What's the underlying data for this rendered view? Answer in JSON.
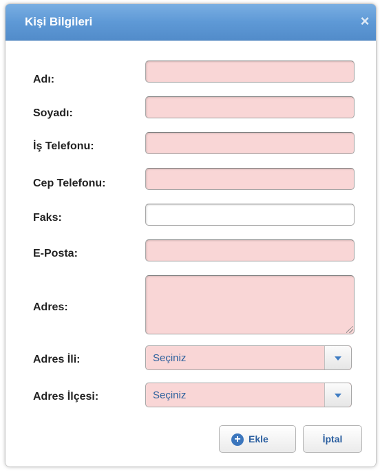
{
  "dialog": {
    "title": "Kişi Bilgileri",
    "close_icon": "×"
  },
  "form": {
    "adi_label": "Adı:",
    "soyadi_label": "Soyadı:",
    "is_telefonu_label": "İş Telefonu:",
    "cep_telefonu_label": "Cep Telefonu:",
    "faks_label": "Faks:",
    "eposta_label": "E-Posta:",
    "adres_label": "Adres:",
    "adres_ili_label": "Adres İli:",
    "adres_ilcesi_label": "Adres İlçesi:",
    "adres_ili_value": "Seçiniz",
    "adres_ilcesi_value": "Seçiniz"
  },
  "buttons": {
    "ekle_label": "Ekle",
    "iptal_label": "İptal"
  },
  "colors": {
    "required_field_bg": "#f9d6d6",
    "titlebar_bg": "#5e99d6",
    "accent": "#3b76bd"
  },
  "icons": {
    "close": "close-icon",
    "add": "plus-circle-icon",
    "dropdown": "chevron-down-icon",
    "resize": "resize-grip-icon"
  }
}
